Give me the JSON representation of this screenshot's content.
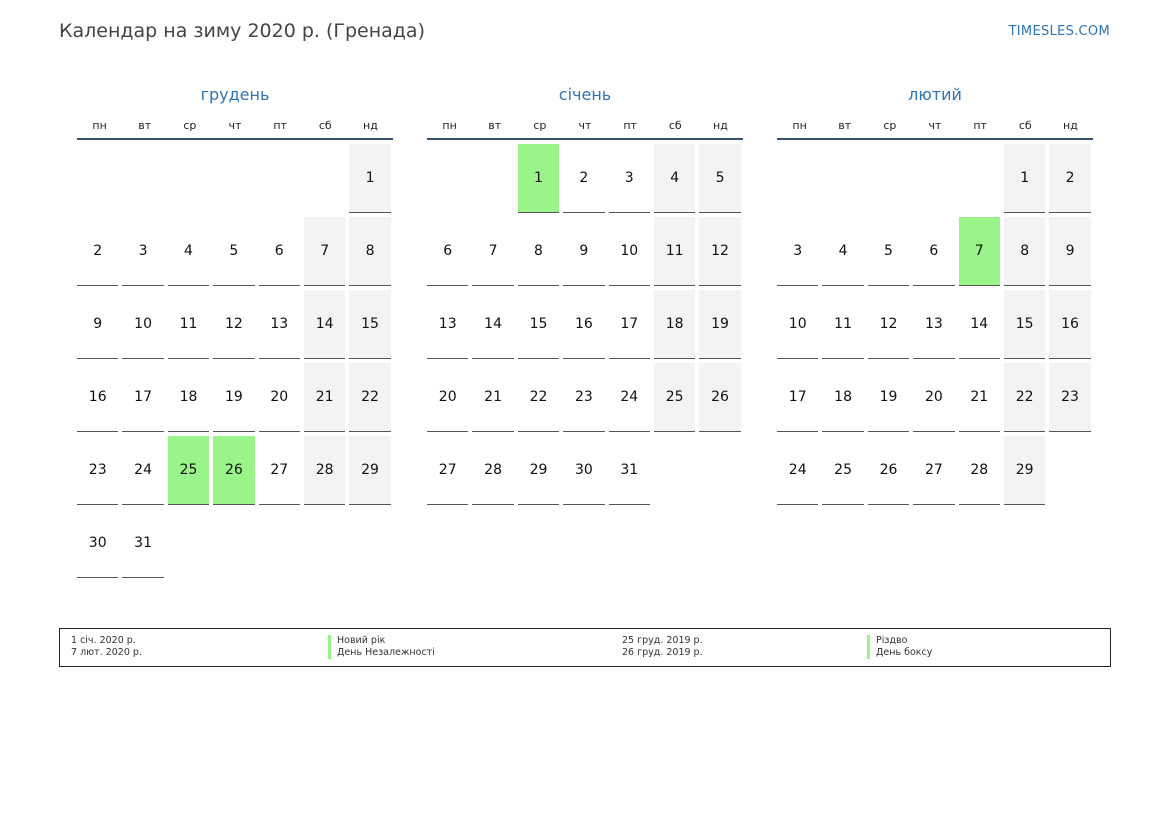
{
  "header": {
    "title": "Календар на зиму 2020 р. (Гренада)",
    "site": "TIMESLES.COM"
  },
  "weekdays": [
    "пн",
    "вт",
    "ср",
    "чт",
    "пт",
    "сб",
    "нд"
  ],
  "months": [
    {
      "name": "грудень",
      "offset": 6,
      "days": 31,
      "holidays": [
        25,
        26
      ],
      "weekends": [
        1,
        7,
        8,
        14,
        15,
        21,
        22,
        28,
        29
      ]
    },
    {
      "name": "січень",
      "offset": 2,
      "days": 31,
      "holidays": [
        1
      ],
      "weekends": [
        4,
        5,
        11,
        12,
        18,
        19,
        25,
        26
      ]
    },
    {
      "name": "лютий",
      "offset": 5,
      "days": 29,
      "holidays": [
        7
      ],
      "weekends": [
        1,
        2,
        8,
        9,
        15,
        16,
        22,
        23,
        29
      ]
    }
  ],
  "legend": {
    "left_dates": [
      "1 січ. 2020 р.",
      "7 лют. 2020 р."
    ],
    "left_names": [
      "Новий рік",
      "День Незалежності"
    ],
    "right_dates": [
      "25 груд. 2019 р.",
      "26 груд. 2019 р."
    ],
    "right_names": [
      "Різдво",
      "День боксу"
    ]
  },
  "colors": {
    "accent": "#2e75b6",
    "holiday": "#99f589",
    "weekend": "#f3f3f3",
    "header_rule": "#35506e"
  }
}
